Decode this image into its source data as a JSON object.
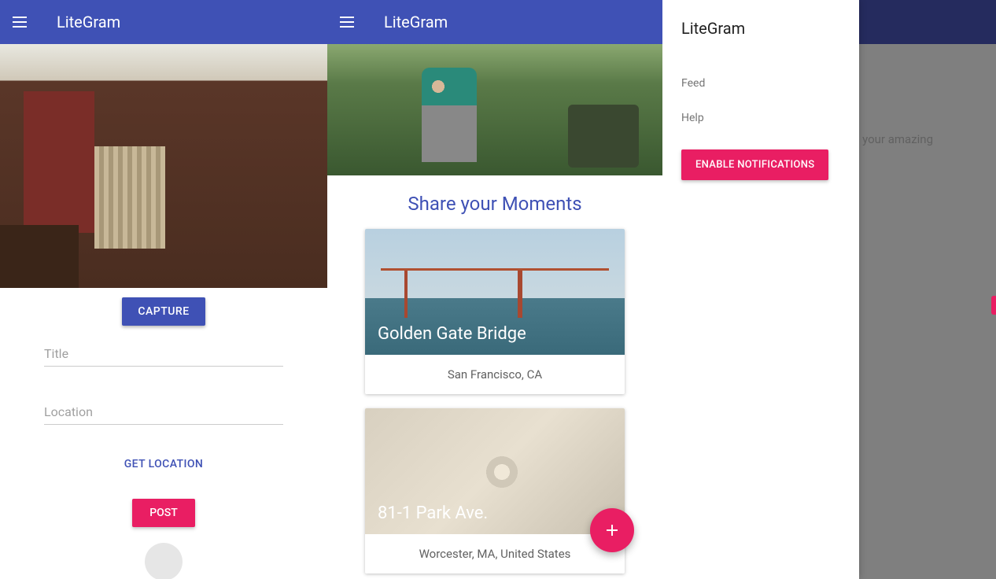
{
  "app": {
    "title": "LiteGram"
  },
  "panel1": {
    "capture_label": "CAPTURE",
    "title_placeholder": "Title",
    "location_placeholder": "Location",
    "get_location_label": "GET LOCATION",
    "post_label": "POST"
  },
  "panel2": {
    "tagline": "Share your Moments",
    "posts": [
      {
        "title": "Golden Gate Bridge",
        "location": "San Francisco, CA"
      },
      {
        "title": "81-1 Park Ave.",
        "location": "Worcester, MA, United States"
      }
    ]
  },
  "panel3": {
    "drawer_title": "LiteGram",
    "items": [
      "Feed",
      "Help"
    ],
    "enable_label": "ENABLE NOTIFICATIONS",
    "bg_text": "e your amazing"
  }
}
